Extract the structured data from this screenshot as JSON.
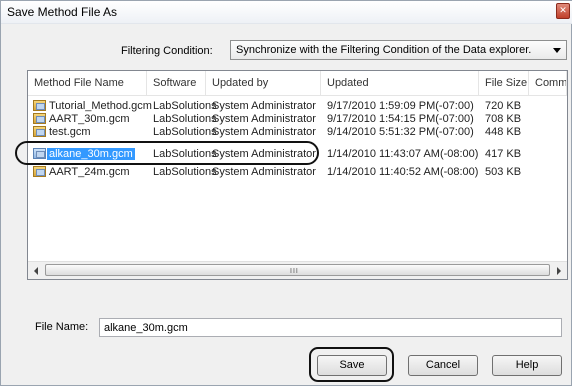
{
  "dialog": {
    "title": "Save Method File As",
    "close_glyph": "✕"
  },
  "filter": {
    "label": "Filtering Condition:",
    "selected": "Synchronize with the Filtering Condition of the Data explorer."
  },
  "list": {
    "columns": [
      "Method File Name",
      "Software",
      "Updated by",
      "Updated",
      "File Size",
      "Comment"
    ],
    "rows": [
      {
        "name": "Tutorial_Method.gcm",
        "software": "LabSolutions",
        "updated_by": "System Administrator",
        "updated": "9/17/2010 1:59:09 PM(-07:00)",
        "size": "720 KB",
        "comment": ""
      },
      {
        "name": "AART_30m.gcm",
        "software": "LabSolutions",
        "updated_by": "System Administrator",
        "updated": "9/17/2010 1:54:15 PM(-07:00)",
        "size": "708 KB",
        "comment": ""
      },
      {
        "name": "test.gcm",
        "software": "LabSolutions",
        "updated_by": "System Administrator",
        "updated": "9/14/2010 5:51:32 PM(-07:00)",
        "size": "448 KB",
        "comment": ""
      },
      {
        "name": "alkane_30m.gcm",
        "software": "LabSolutions",
        "updated_by": "System Administrator",
        "updated": "1/14/2010 11:43:07 AM(-08:00)",
        "size": "417 KB",
        "comment": ""
      },
      {
        "name": "AART_24m.gcm",
        "software": "LabSolutions",
        "updated_by": "System Administrator",
        "updated": "1/14/2010 11:40:52 AM(-08:00)",
        "size": "503 KB",
        "comment": ""
      }
    ],
    "selected_row": "alkane_30m.gcm",
    "scroll_grip": "III"
  },
  "file_name": {
    "label": "File Name:",
    "value": "alkane_30m.gcm"
  },
  "buttons": {
    "save": "Save",
    "cancel": "Cancel",
    "help": "Help"
  },
  "icons": {
    "file": "method-file-icon"
  },
  "colors": {
    "selection": "#3399ff",
    "window_bg": "#f0f0f0"
  }
}
